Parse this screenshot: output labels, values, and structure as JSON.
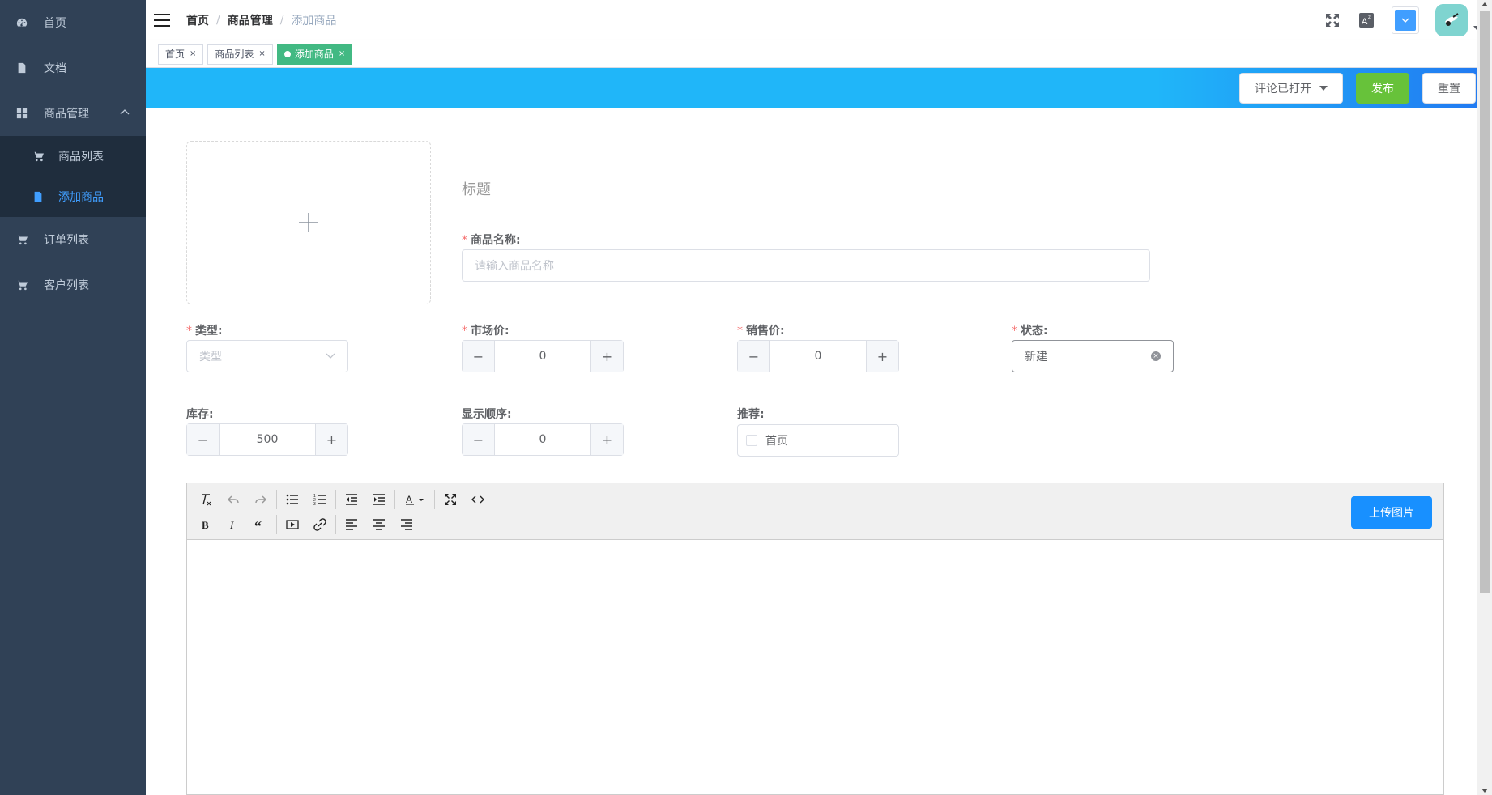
{
  "sidebar": {
    "items": [
      {
        "label": "首页",
        "icon": "dashboard-icon"
      },
      {
        "label": "文档",
        "icon": "document-icon"
      },
      {
        "label": "商品管理",
        "icon": "grid-icon",
        "expanded": true,
        "children": [
          {
            "label": "商品列表",
            "icon": "cart-icon",
            "active": false
          },
          {
            "label": "添加商品",
            "icon": "file-icon",
            "active": true
          }
        ]
      },
      {
        "label": "订单列表",
        "icon": "cart-icon"
      },
      {
        "label": "客户列表",
        "icon": "cart-icon"
      }
    ]
  },
  "navbar": {
    "breadcrumb": [
      "首页",
      "商品管理",
      "添加商品"
    ],
    "separator": "/"
  },
  "tags": [
    {
      "label": "首页",
      "active": false
    },
    {
      "label": "商品列表",
      "active": false
    },
    {
      "label": "添加商品",
      "active": true
    }
  ],
  "tag_close": "×",
  "sticky": {
    "comment_dropdown": "评论已打开",
    "publish": "发布",
    "reset": "重置"
  },
  "form": {
    "title_placeholder": "标题",
    "name": {
      "label": "商品名称:",
      "placeholder": "请输入商品名称",
      "required": true
    },
    "type": {
      "label": "类型:",
      "placeholder": "类型",
      "required": true
    },
    "market_price": {
      "label": "市场价:",
      "value": "0",
      "required": true
    },
    "sale_price": {
      "label": "销售价:",
      "value": "0",
      "required": true
    },
    "status": {
      "label": "状态:",
      "value": "新建",
      "required": true
    },
    "stock": {
      "label": "库存:",
      "value": "500"
    },
    "order": {
      "label": "显示顺序:",
      "value": "0"
    },
    "recommend": {
      "label": "推荐:",
      "option": "首页",
      "checked": false
    },
    "minus": "−",
    "plus": "+",
    "required_mark": "*"
  },
  "editor": {
    "upload_image": "上传图片"
  },
  "colors": {
    "sidebar_bg": "#304156",
    "submenu_bg": "#1f2d3d",
    "active_blue": "#409eff",
    "tag_green": "#42b983",
    "publish_green": "#67c23a",
    "banner_blue": "#20b6f9",
    "upload_blue": "#1890ff"
  }
}
